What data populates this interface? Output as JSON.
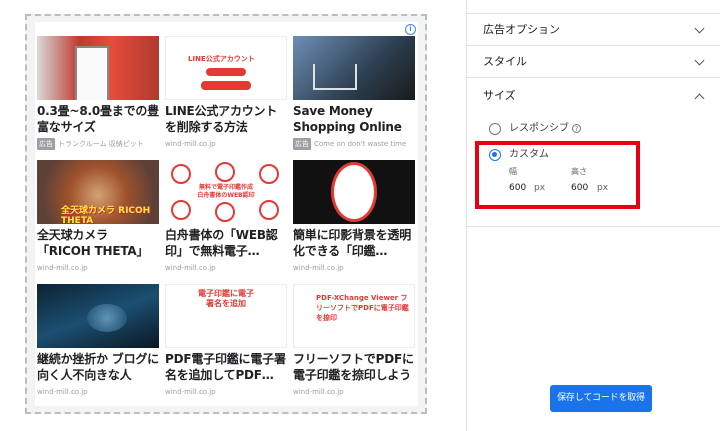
{
  "preview": {
    "adchoices_label": "i",
    "cards": [
      {
        "title": "0.3畳~8.0畳までの豊富なサイズ",
        "badge": "広告",
        "source": "トランクルーム 収納ピット",
        "thumb_text": ""
      },
      {
        "title": "LINE公式アカウントを削除する方法",
        "badge": "",
        "source": "wind-mill.co.jp",
        "thumb_text": "LINE公式アカウント"
      },
      {
        "title": "Save Money Shopping Online",
        "badge": "広告",
        "source": "Come on don't waste time",
        "thumb_text": ""
      },
      {
        "title": "全天球カメラ「RICOH THETA」画像の…",
        "badge": "",
        "source": "wind-mill.co.jp",
        "thumb_text": "全天球カメラ RICOH THETA"
      },
      {
        "title": "白舟書体の「WEB認印」で無料電子…",
        "badge": "",
        "source": "wind-mill.co.jp",
        "thumb_text": "無料で電子印鑑作成 白舟書体のWEB認印"
      },
      {
        "title": "簡単に印影背景を透明化できる「印鑑…",
        "badge": "",
        "source": "wind-mill.co.jp",
        "thumb_text": ""
      },
      {
        "title": "継続か挫折か ブログに向く人不向きな人",
        "badge": "",
        "source": "wind-mill.co.jp",
        "thumb_text": ""
      },
      {
        "title": "PDF電子印鑑に電子署名を追加してPDF…",
        "badge": "",
        "source": "wind-mill.co.jp",
        "thumb_text": "電子印鑑に電子署名を追加"
      },
      {
        "title": "フリーソフトでPDFに電子印鑑を捺印しよう",
        "badge": "",
        "source": "wind-mill.co.jp",
        "thumb_text": "PDF-XChange Viewer フリーソフトでPDFに電子印鑑を捺印"
      }
    ]
  },
  "panel": {
    "ad_options_label": "広告オプション",
    "style_label": "スタイル",
    "size_label": "サイズ",
    "responsive_label": "レスポンシブ",
    "help_glyph": "?",
    "custom_label": "カスタム",
    "width_label": "幅",
    "height_label": "高さ",
    "width_value": "600",
    "height_value": "600",
    "unit": "px",
    "selected_size": "custom",
    "save_button": "保存してコードを取得"
  },
  "colors": {
    "accent": "#1a73e8",
    "highlight_box": "#e50012"
  }
}
